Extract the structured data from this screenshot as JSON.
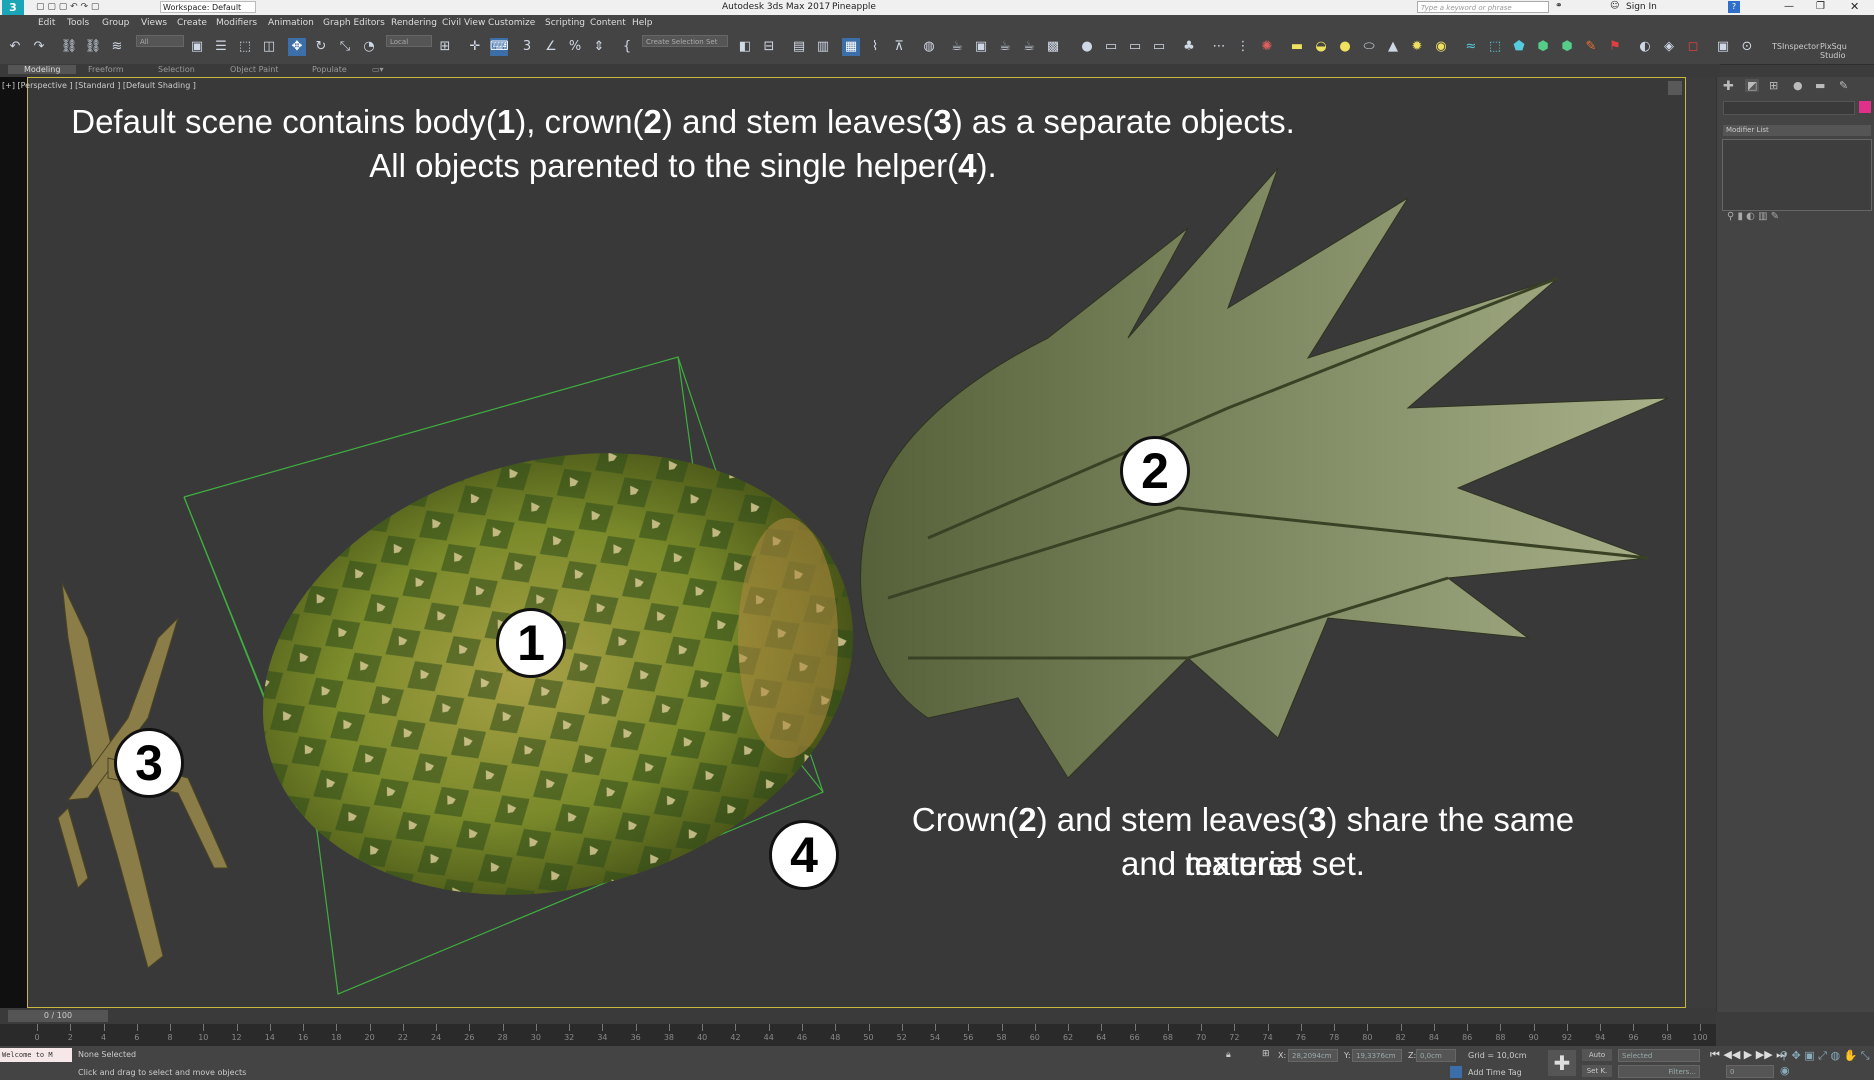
{
  "titlebar": {
    "workspace": "Workspace: Default",
    "app_title": "Autodesk 3ds Max 2017",
    "file_name": "Pineapple",
    "search_placeholder": "Type a keyword or phrase",
    "sign_in": "Sign In"
  },
  "menu": [
    "Edit",
    "Tools",
    "Group",
    "Views",
    "Create",
    "Modifiers",
    "Animation",
    "Graph Editors",
    "Rendering",
    "Civil View",
    "Customize",
    "Scripting",
    "Content",
    "Help"
  ],
  "toolbar": {
    "filter": "All",
    "coord": "Local",
    "selection_set": "Create Selection Set",
    "extra_labels": [
      "TSInspector",
      "PixSqu Studio"
    ]
  },
  "ribbon_tabs": [
    "Modeling",
    "Freeform",
    "Selection",
    "Object Paint",
    "Populate"
  ],
  "viewport": {
    "label": "[+] [Perspective ] [Standard ] [Default Shading ]",
    "annotation_top_line1": "Default scene contains body(1), crown(2) and stem leaves(3) as a separate objects.",
    "annotation_top_line2": "All objects parented to the single helper(4).",
    "annotation_bottom_line1": "Crown(2) and stem leaves(3) share the same material",
    "annotation_bottom_line2": "and textures set.",
    "badges": [
      "1",
      "2",
      "3",
      "4"
    ]
  },
  "command_panel": {
    "modifier_list": "Modifier List"
  },
  "timeline": {
    "frame_label": "0 / 100",
    "ticks": [
      "0",
      "2",
      "4",
      "6",
      "8",
      "10",
      "12",
      "14",
      "16",
      "18",
      "20",
      "22",
      "24",
      "26",
      "28",
      "30",
      "32",
      "34",
      "36",
      "38",
      "40",
      "42",
      "44",
      "46",
      "48",
      "50",
      "52",
      "54",
      "56",
      "58",
      "60",
      "62",
      "64",
      "66",
      "68",
      "70",
      "72",
      "74",
      "76",
      "78",
      "80",
      "82",
      "84",
      "86",
      "88",
      "90",
      "92",
      "94",
      "96",
      "98",
      "100"
    ]
  },
  "status": {
    "welcome": "Welcome to M",
    "selection": "None Selected",
    "prompt": "Click and drag to select and move objects",
    "x_label": "X:",
    "x_value": "28,2094cm",
    "y_label": "Y:",
    "y_value": "19,3376cm",
    "z_label": "Z:",
    "z_value": "0,0cm",
    "grid": "Grid = 10,0cm",
    "add_time_tag": "Add Time Tag",
    "auto": "Auto",
    "selected": "Selected",
    "set_k": "Set K.",
    "filters": "Filters...",
    "frame": "0"
  },
  "colors": {
    "viewport_border": "#c8b840",
    "bbox_line": "#3fae3f",
    "accent_pink": "#e0308a"
  }
}
